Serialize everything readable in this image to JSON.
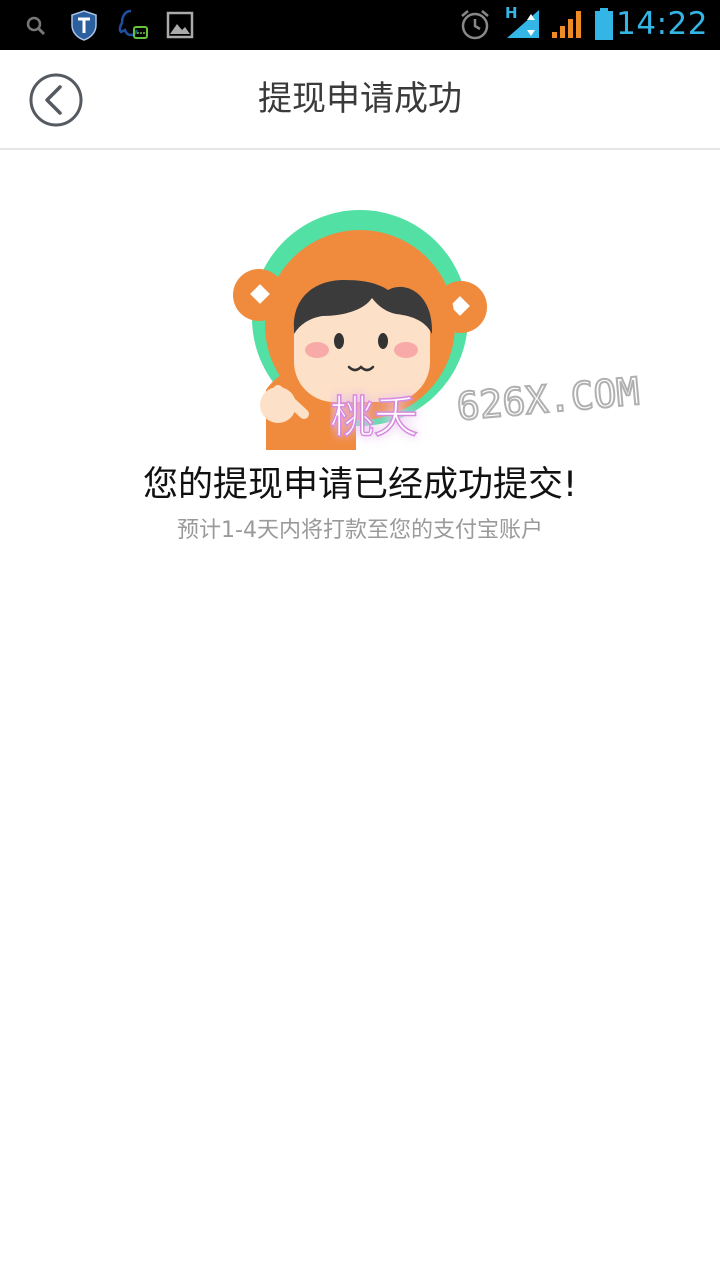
{
  "status_bar": {
    "time": "14:22",
    "network_label": "H",
    "colors": {
      "background": "#000000",
      "time": "#33b5e5",
      "battery": "#33b5e5",
      "signal": "#f08a24"
    },
    "icons": [
      "search-icon",
      "shield-icon",
      "qq-icon",
      "image-icon",
      "alarm-icon",
      "data-signal-icon",
      "cell-signal-icon",
      "battery-icon"
    ]
  },
  "header": {
    "title": "提现申请成功",
    "back_icon": "chevron-left-icon"
  },
  "main": {
    "message": "您的提现申请已经成功提交!",
    "sub_message": "预计1-4天内将打款至您的支付宝账户",
    "watermark_text": "桃夭 626X.COM"
  }
}
